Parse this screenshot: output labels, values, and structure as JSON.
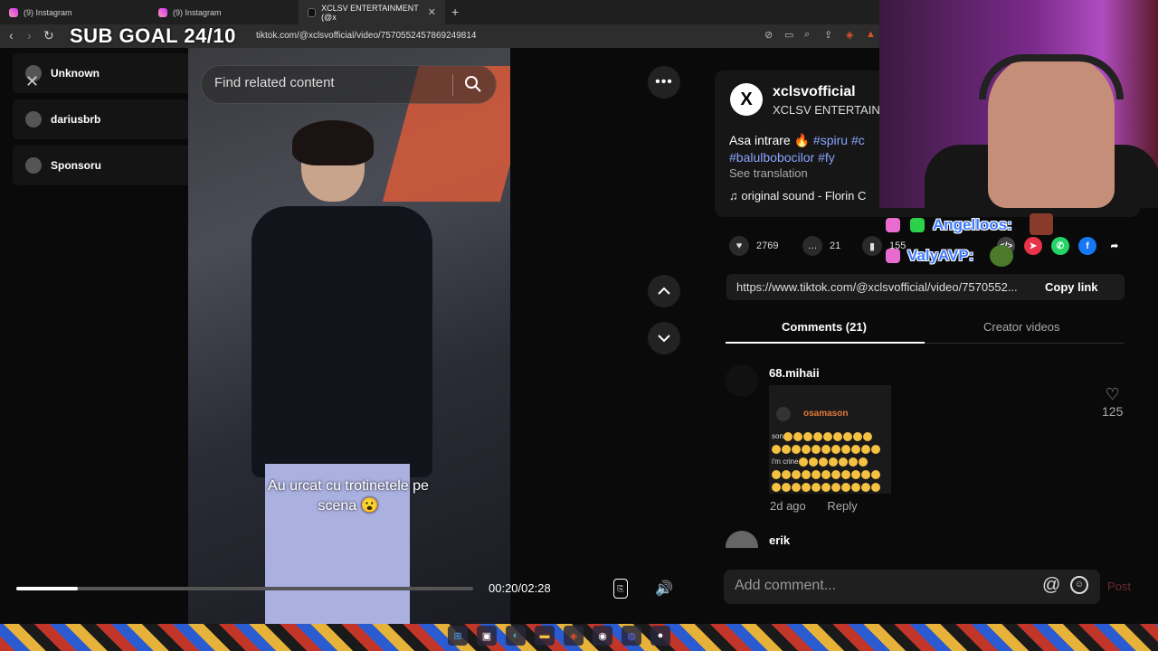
{
  "browser": {
    "tabs": [
      {
        "title": "(9) Instagram",
        "active": false
      },
      {
        "title": "(9) Instagram",
        "active": false
      },
      {
        "title": "XCLSV ENTERTAINMENT (@x",
        "active": true
      }
    ],
    "url": "tiktok.com/@xclsvofficial/video/7570552457869249814"
  },
  "overlay": {
    "sub_goal": "SUB GOAL 24/10"
  },
  "left_panel": {
    "accounts": [
      {
        "name": "Unknown"
      },
      {
        "name": "dariusbrb"
      },
      {
        "name": "Sponsoru"
      }
    ]
  },
  "search": {
    "placeholder": "Find related content"
  },
  "video": {
    "caption_line1": "Au urcat cu trotinetele pe",
    "caption_line2": "scena 😮",
    "time": "00:20/02:28",
    "progress": 0.135
  },
  "author": {
    "username": "xclsvofficial",
    "display_name": "XCLSV ENTERTAINI",
    "description_text": "Asa intrare 🔥",
    "hashtags": [
      "#spiru",
      "#c",
      "#balulbobocilor",
      "#fy"
    ],
    "see_translation": "See translation",
    "sound": "original sound - Florin C"
  },
  "actions": {
    "likes": "2769",
    "comments": "21",
    "saves": "155"
  },
  "link": {
    "url": "https://www.tiktok.com/@xclsvofficial/video/7570552...",
    "copy_label": "Copy link"
  },
  "tabs": {
    "comments": "Comments (21)",
    "creator": "Creator videos"
  },
  "comments": [
    {
      "user": "68.mihaii",
      "gif_user": "osamason",
      "gif_line1": "son",
      "gif_line2": "i'm crine",
      "date": "2d ago",
      "reply": "Reply",
      "likes": "125"
    },
    {
      "user": "erik"
    }
  ],
  "add_comment": {
    "placeholder": "Add comment...",
    "at": "@",
    "post": "Post"
  },
  "stream_chat": [
    {
      "name": "Angelloos:"
    },
    {
      "name": "ValyAVP:"
    }
  ]
}
